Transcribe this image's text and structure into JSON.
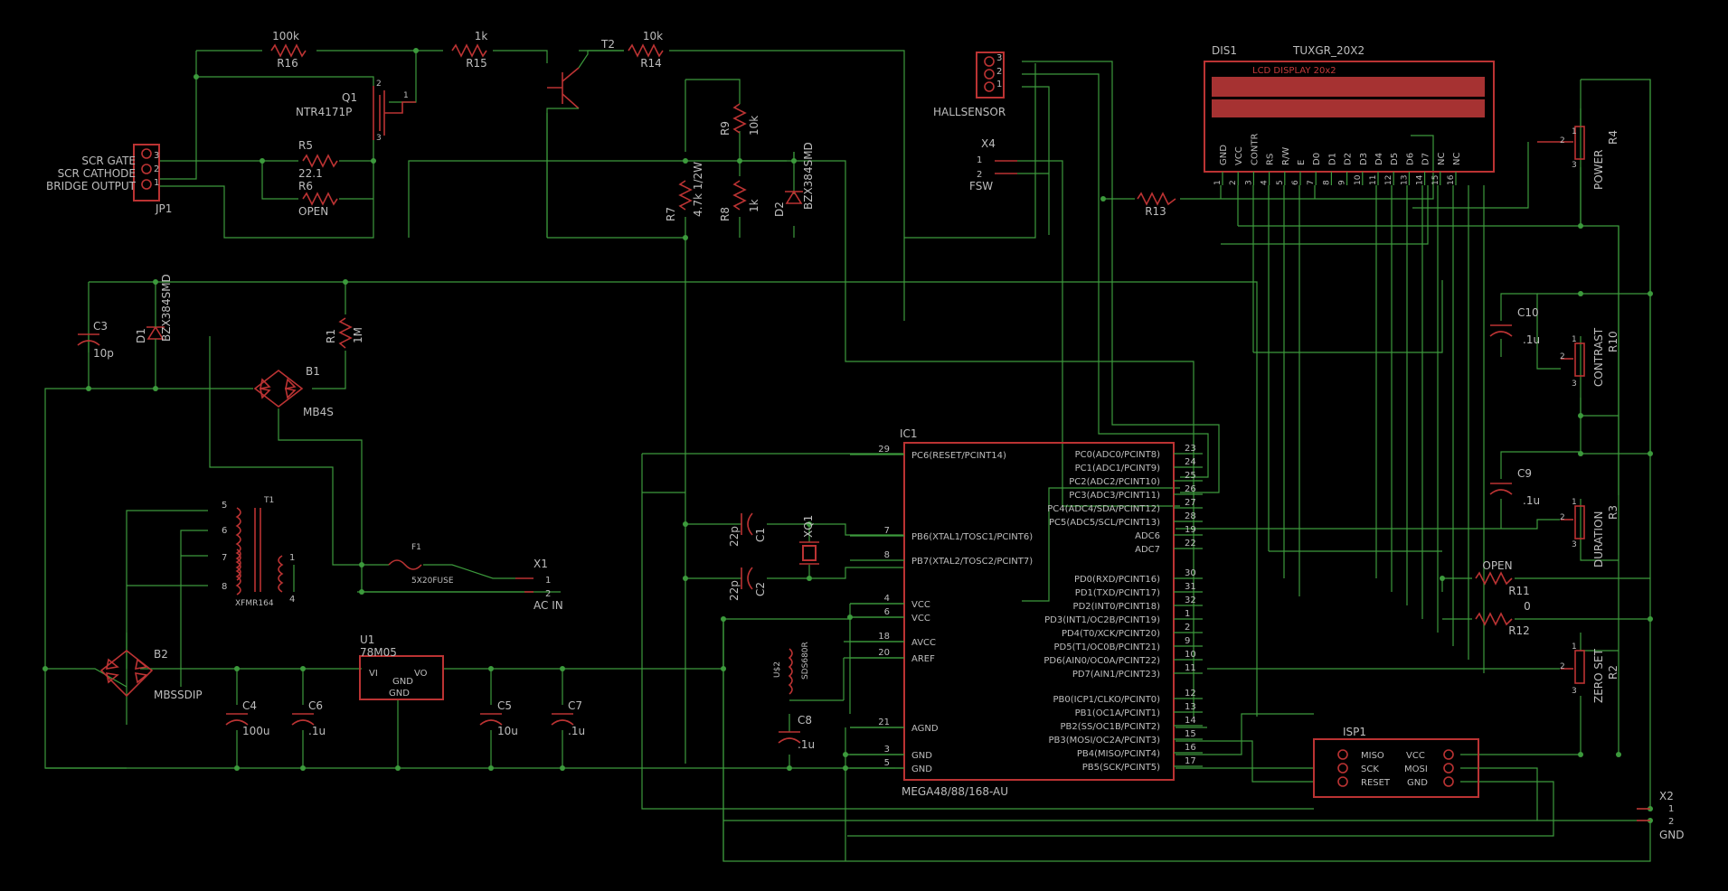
{
  "schematic": {
    "components": [
      {
        "ref": "R16",
        "value": "100k"
      },
      {
        "ref": "R15",
        "value": "1k"
      },
      {
        "ref": "T2",
        "value": ""
      },
      {
        "ref": "R14",
        "value": "10k"
      },
      {
        "ref": "Q1",
        "value": "NTR4171P"
      },
      {
        "ref": "R5",
        "value": "22.1"
      },
      {
        "ref": "R6",
        "value": "OPEN"
      },
      {
        "ref": "R9",
        "value": "10k"
      },
      {
        "ref": "R7",
        "value": "4.7k 1/2W"
      },
      {
        "ref": "R8",
        "value": "1k"
      },
      {
        "ref": "D2",
        "value": "BZX384SMD"
      },
      {
        "ref": "D1",
        "value": "BZX384SMD"
      },
      {
        "ref": "C3",
        "value": "10p"
      },
      {
        "ref": "R1",
        "value": "1M"
      },
      {
        "ref": "B1",
        "value": "MB4S"
      },
      {
        "ref": "T1",
        "value": "XFMR164"
      },
      {
        "ref": "F1",
        "value": "5X20FUSE"
      },
      {
        "ref": "B2",
        "value": "MBSSDIP"
      },
      {
        "ref": "U1",
        "value": "78M05"
      },
      {
        "ref": "C4",
        "value": "100u"
      },
      {
        "ref": "C6",
        "value": ".1u"
      },
      {
        "ref": "C5",
        "value": "10u"
      },
      {
        "ref": "C7",
        "value": ".1u"
      },
      {
        "ref": "C1",
        "value": "22p"
      },
      {
        "ref": "C2",
        "value": "22p"
      },
      {
        "ref": "XQ1",
        "value": ""
      },
      {
        "ref": "C8",
        "value": ".1u"
      },
      {
        "ref": "U$2",
        "value": "SDS680R"
      },
      {
        "ref": "R13",
        "value": ""
      },
      {
        "ref": "C10",
        "value": ".1u"
      },
      {
        "ref": "R4",
        "value": "POWER"
      },
      {
        "ref": "R10",
        "value": "CONTRAST"
      },
      {
        "ref": "C9",
        "value": ".1u"
      },
      {
        "ref": "R3",
        "value": "DURATION"
      },
      {
        "ref": "R11",
        "value": "OPEN"
      },
      {
        "ref": "R12",
        "value": "0"
      },
      {
        "ref": "R2",
        "value": "ZERO SET"
      }
    ],
    "jp1": {
      "ref": "JP1",
      "pins": [
        "3",
        "2",
        "1"
      ],
      "labels": [
        "SCR GATE",
        "SCR CATHODE",
        "BRIDGE OUTPUT"
      ]
    },
    "hall": {
      "ref": "HALLSENSOR",
      "pins": [
        "3",
        "2",
        "1"
      ]
    },
    "x4": {
      "ref": "X4",
      "name": "FSW",
      "pins": [
        "1",
        "2"
      ]
    },
    "x1": {
      "ref": "X1",
      "name": "AC IN",
      "pins": [
        "1",
        "2"
      ]
    },
    "x2": {
      "ref": "X2",
      "name": "GND",
      "pins": [
        "1",
        "2"
      ]
    },
    "u1_pins": {
      "vi": "VI",
      "vo": "VO",
      "gnd1": "GND",
      "gnd2": "GND"
    },
    "t1_pins": [
      "5",
      "6",
      "7",
      "8",
      "1",
      "4"
    ],
    "lcd": {
      "ref": "DIS1",
      "part": "TUXGR_20X2",
      "title": "LCD DISPLAY 20x2",
      "pins": [
        "GND",
        "VCC",
        "CONTR",
        "RS",
        "R/W",
        "E",
        "D0",
        "D1",
        "D2",
        "D3",
        "D4",
        "D5",
        "D6",
        "D7",
        "NC",
        "NC"
      ],
      "nums": [
        "1",
        "2",
        "3",
        "4",
        "5",
        "6",
        "7",
        "8",
        "9",
        "10",
        "11",
        "12",
        "13",
        "14",
        "15",
        "16"
      ]
    },
    "ic1": {
      "ref": "IC1",
      "part": "MEGA48/88/168-AU",
      "left": [
        {
          "name": "PC6(RESET/PCINT14)",
          "num": "29"
        },
        {
          "name": "PB6(XTAL1/TOSC1/PCINT6)",
          "num": "7"
        },
        {
          "name": "PB7(XTAL2/TOSC2/PCINT7)",
          "num": "8"
        },
        {
          "name": "VCC",
          "num": "4"
        },
        {
          "name": "VCC",
          "num": "6"
        },
        {
          "name": "AVCC",
          "num": "18"
        },
        {
          "name": "AREF",
          "num": "20"
        },
        {
          "name": "AGND",
          "num": "21"
        },
        {
          "name": "GND",
          "num": "3"
        },
        {
          "name": "GND",
          "num": "5"
        }
      ],
      "right": [
        {
          "name": "PC0(ADC0/PCINT8)",
          "num": "23"
        },
        {
          "name": "PC1(ADC1/PCINT9)",
          "num": "24"
        },
        {
          "name": "PC2(ADC2/PCINT10)",
          "num": "25"
        },
        {
          "name": "PC3(ADC3/PCINT11)",
          "num": "26"
        },
        {
          "name": "PC4(ADC4/SDA/PCINT12)",
          "num": "27"
        },
        {
          "name": "PC5(ADC5/SCL/PCINT13)",
          "num": "28"
        },
        {
          "name": "ADC6",
          "num": "19"
        },
        {
          "name": "ADC7",
          "num": "22"
        },
        {
          "name": "PD0(RXD/PCINT16)",
          "num": "30"
        },
        {
          "name": "PD1(TXD/PCINT17)",
          "num": "31"
        },
        {
          "name": "PD2(INT0/PCINT18)",
          "num": "32"
        },
        {
          "name": "PD3(INT1/OC2B/PCINT19)",
          "num": "1"
        },
        {
          "name": "PD4(T0/XCK/PCINT20)",
          "num": "2"
        },
        {
          "name": "PD5(T1/OC0B/PCINT21)",
          "num": "9"
        },
        {
          "name": "PD6(AIN0/OC0A/PCINT22)",
          "num": "10"
        },
        {
          "name": "PD7(AIN1/PCINT23)",
          "num": "11"
        },
        {
          "name": "PB0(ICP1/CLKO/PCINT0)",
          "num": "12"
        },
        {
          "name": "PB1(OC1A/PCINT1)",
          "num": "13"
        },
        {
          "name": "PB2(SS/OC1B/PCINT2)",
          "num": "14"
        },
        {
          "name": "PB3(MOSI/OC2A/PCINT3)",
          "num": "15"
        },
        {
          "name": "PB4(MISO/PCINT4)",
          "num": "16"
        },
        {
          "name": "PB5(SCK/PCINT5)",
          "num": "17"
        }
      ]
    },
    "isp": {
      "ref": "ISP1",
      "left": [
        "MISO",
        "SCK",
        "RESET"
      ],
      "right": [
        "VCC",
        "MOSI",
        "GND"
      ]
    },
    "pot_pins": {
      "p1": "1",
      "p2": "2",
      "p3": "3"
    }
  }
}
